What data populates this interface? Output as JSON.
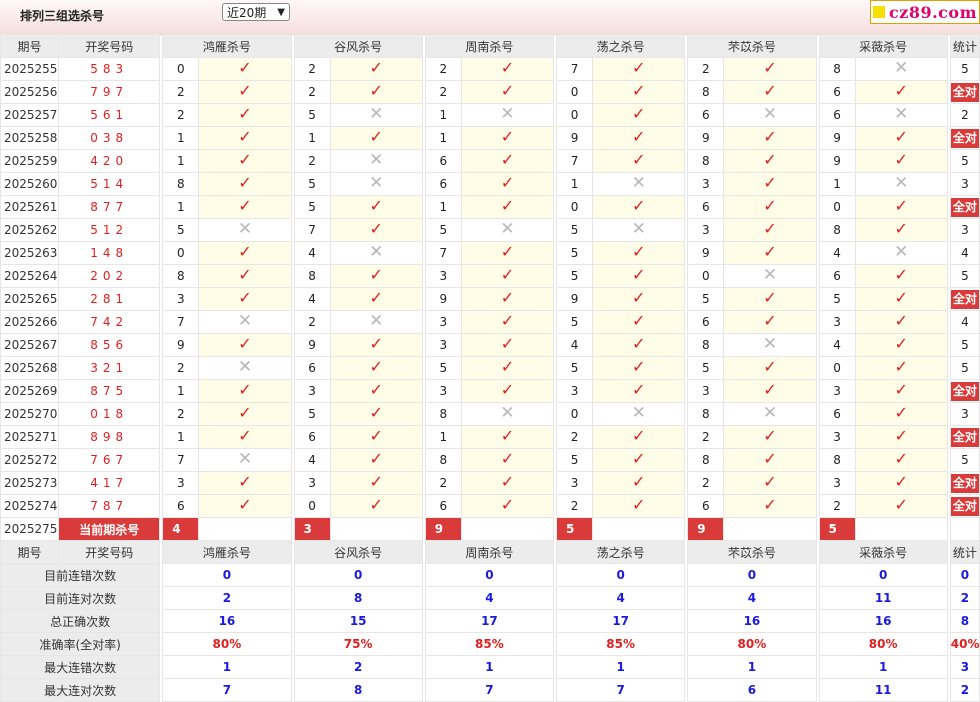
{
  "header": {
    "title": "排列三组选杀号",
    "period_select": "近20期",
    "logo_text": "cz89.com"
  },
  "columns": {
    "issue": "期号",
    "number": "开奖号码",
    "experts": [
      "鸿雁杀号",
      "谷风杀号",
      "周南杀号",
      "荡之杀号",
      "芣苡杀号",
      "采薇杀号"
    ],
    "stat": "统计"
  },
  "rows": [
    {
      "issue": "2025255",
      "num": "583",
      "kills": [
        0,
        2,
        2,
        7,
        2,
        8
      ],
      "hits": [
        1,
        1,
        1,
        1,
        1,
        0
      ],
      "stat": "5"
    },
    {
      "issue": "2025256",
      "num": "797",
      "kills": [
        2,
        2,
        2,
        0,
        8,
        6
      ],
      "hits": [
        1,
        1,
        1,
        1,
        1,
        1
      ],
      "stat": "全对"
    },
    {
      "issue": "2025257",
      "num": "561",
      "kills": [
        2,
        5,
        1,
        0,
        6,
        6
      ],
      "hits": [
        1,
        0,
        0,
        1,
        0,
        0
      ],
      "stat": "2"
    },
    {
      "issue": "2025258",
      "num": "038",
      "kills": [
        1,
        1,
        1,
        9,
        9,
        9
      ],
      "hits": [
        1,
        1,
        1,
        1,
        1,
        1
      ],
      "stat": "全对"
    },
    {
      "issue": "2025259",
      "num": "420",
      "kills": [
        1,
        2,
        6,
        7,
        8,
        9
      ],
      "hits": [
        1,
        0,
        1,
        1,
        1,
        1
      ],
      "stat": "5"
    },
    {
      "issue": "2025260",
      "num": "514",
      "kills": [
        8,
        5,
        6,
        1,
        3,
        1
      ],
      "hits": [
        1,
        0,
        1,
        0,
        1,
        0
      ],
      "stat": "3"
    },
    {
      "issue": "2025261",
      "num": "877",
      "kills": [
        1,
        5,
        1,
        0,
        6,
        0
      ],
      "hits": [
        1,
        1,
        1,
        1,
        1,
        1
      ],
      "stat": "全对"
    },
    {
      "issue": "2025262",
      "num": "512",
      "kills": [
        5,
        7,
        5,
        5,
        3,
        8
      ],
      "hits": [
        0,
        1,
        0,
        0,
        1,
        1
      ],
      "stat": "3"
    },
    {
      "issue": "2025263",
      "num": "148",
      "kills": [
        0,
        4,
        7,
        5,
        9,
        4
      ],
      "hits": [
        1,
        0,
        1,
        1,
        1,
        0
      ],
      "stat": "4"
    },
    {
      "issue": "2025264",
      "num": "202",
      "kills": [
        8,
        8,
        3,
        5,
        0,
        6
      ],
      "hits": [
        1,
        1,
        1,
        1,
        0,
        1
      ],
      "stat": "5"
    },
    {
      "issue": "2025265",
      "num": "281",
      "kills": [
        3,
        4,
        9,
        9,
        5,
        5
      ],
      "hits": [
        1,
        1,
        1,
        1,
        1,
        1
      ],
      "stat": "全对"
    },
    {
      "issue": "2025266",
      "num": "742",
      "kills": [
        7,
        2,
        3,
        5,
        6,
        3
      ],
      "hits": [
        0,
        0,
        1,
        1,
        1,
        1
      ],
      "stat": "4"
    },
    {
      "issue": "2025267",
      "num": "856",
      "kills": [
        9,
        9,
        3,
        4,
        8,
        4
      ],
      "hits": [
        1,
        1,
        1,
        1,
        0,
        1
      ],
      "stat": "5"
    },
    {
      "issue": "2025268",
      "num": "321",
      "kills": [
        2,
        6,
        5,
        5,
        5,
        0
      ],
      "hits": [
        0,
        1,
        1,
        1,
        1,
        1
      ],
      "stat": "5"
    },
    {
      "issue": "2025269",
      "num": "875",
      "kills": [
        1,
        3,
        3,
        3,
        3,
        3
      ],
      "hits": [
        1,
        1,
        1,
        1,
        1,
        1
      ],
      "stat": "全对"
    },
    {
      "issue": "2025270",
      "num": "018",
      "kills": [
        2,
        5,
        8,
        0,
        8,
        6
      ],
      "hits": [
        1,
        1,
        0,
        0,
        0,
        1
      ],
      "stat": "3"
    },
    {
      "issue": "2025271",
      "num": "898",
      "kills": [
        1,
        6,
        1,
        2,
        2,
        3
      ],
      "hits": [
        1,
        1,
        1,
        1,
        1,
        1
      ],
      "stat": "全对"
    },
    {
      "issue": "2025272",
      "num": "767",
      "kills": [
        7,
        4,
        8,
        5,
        8,
        8
      ],
      "hits": [
        0,
        1,
        1,
        1,
        1,
        1
      ],
      "stat": "5"
    },
    {
      "issue": "2025273",
      "num": "417",
      "kills": [
        3,
        3,
        2,
        3,
        2,
        3
      ],
      "hits": [
        1,
        1,
        1,
        1,
        1,
        1
      ],
      "stat": "全对"
    },
    {
      "issue": "2025274",
      "num": "787",
      "kills": [
        6,
        0,
        6,
        2,
        6,
        2
      ],
      "hits": [
        1,
        1,
        1,
        1,
        1,
        1
      ],
      "stat": "全对"
    }
  ],
  "current": {
    "issue": "2025275",
    "label": "当前期杀号",
    "kills": [
      "4",
      "3",
      "9",
      "5",
      "9",
      "5"
    ]
  },
  "summary": [
    {
      "label": "目前连错次数",
      "values": [
        "0",
        "0",
        "0",
        "0",
        "0",
        "0"
      ],
      "stat": "0",
      "style": "sv"
    },
    {
      "label": "目前连对次数",
      "values": [
        "2",
        "8",
        "4",
        "4",
        "4",
        "11"
      ],
      "stat": "2",
      "style": "sv"
    },
    {
      "label": "总正确次数",
      "values": [
        "16",
        "15",
        "17",
        "17",
        "16",
        "16"
      ],
      "stat": "8",
      "style": "sv"
    },
    {
      "label": "准确率(全对率)",
      "values": [
        "80%",
        "75%",
        "85%",
        "85%",
        "80%",
        "80%"
      ],
      "stat": "40%",
      "style": "sp"
    },
    {
      "label": "最大连错次数",
      "values": [
        "1",
        "2",
        "1",
        "1",
        "1",
        "1"
      ],
      "stat": "3",
      "style": "sv"
    },
    {
      "label": "最大连对次数",
      "values": [
        "7",
        "8",
        "7",
        "7",
        "6",
        "11"
      ],
      "stat": "2",
      "style": "sv"
    }
  ],
  "icons": {
    "hit": "check-icon",
    "miss": "cross-icon"
  },
  "colors": {
    "accent": "#d93a3a",
    "hit": "#e02020",
    "miss": "#b8b8b8",
    "summary_value": "#1a1ae0"
  }
}
